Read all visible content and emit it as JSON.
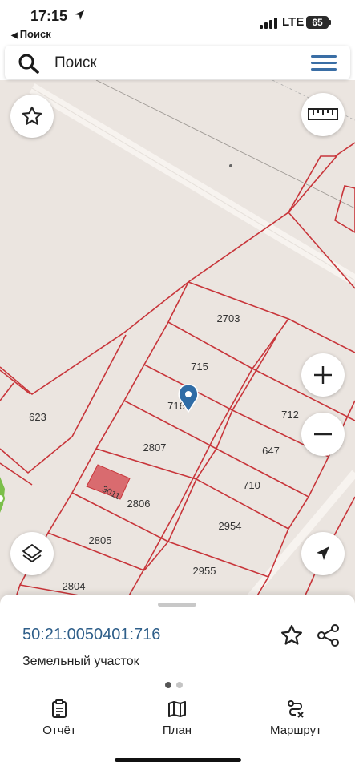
{
  "status_bar": {
    "time": "17:15",
    "back_label": "Поиск",
    "network": "LTE",
    "battery": "65"
  },
  "search": {
    "placeholder": "Поиск"
  },
  "map": {
    "colors": {
      "background": "#ebe5e0",
      "parcel_border": "#c8353a",
      "pin": "#2f6ca6",
      "selected_fill": "#d96b6f"
    },
    "parcel_labels": [
      "2703",
      "715",
      "716",
      "712",
      "623",
      "2807",
      "647",
      "710",
      "2806",
      "2954",
      "2805",
      "2955",
      "2804",
      "3011"
    ]
  },
  "sheet": {
    "cadastral_number": "50:21:0050401:716",
    "parcel_type": "Земельный участок"
  },
  "tabs": [
    {
      "label": "Отчёт",
      "icon": "report-icon"
    },
    {
      "label": "План",
      "icon": "map-plan-icon"
    },
    {
      "label": "Маршрут",
      "icon": "route-icon"
    }
  ]
}
